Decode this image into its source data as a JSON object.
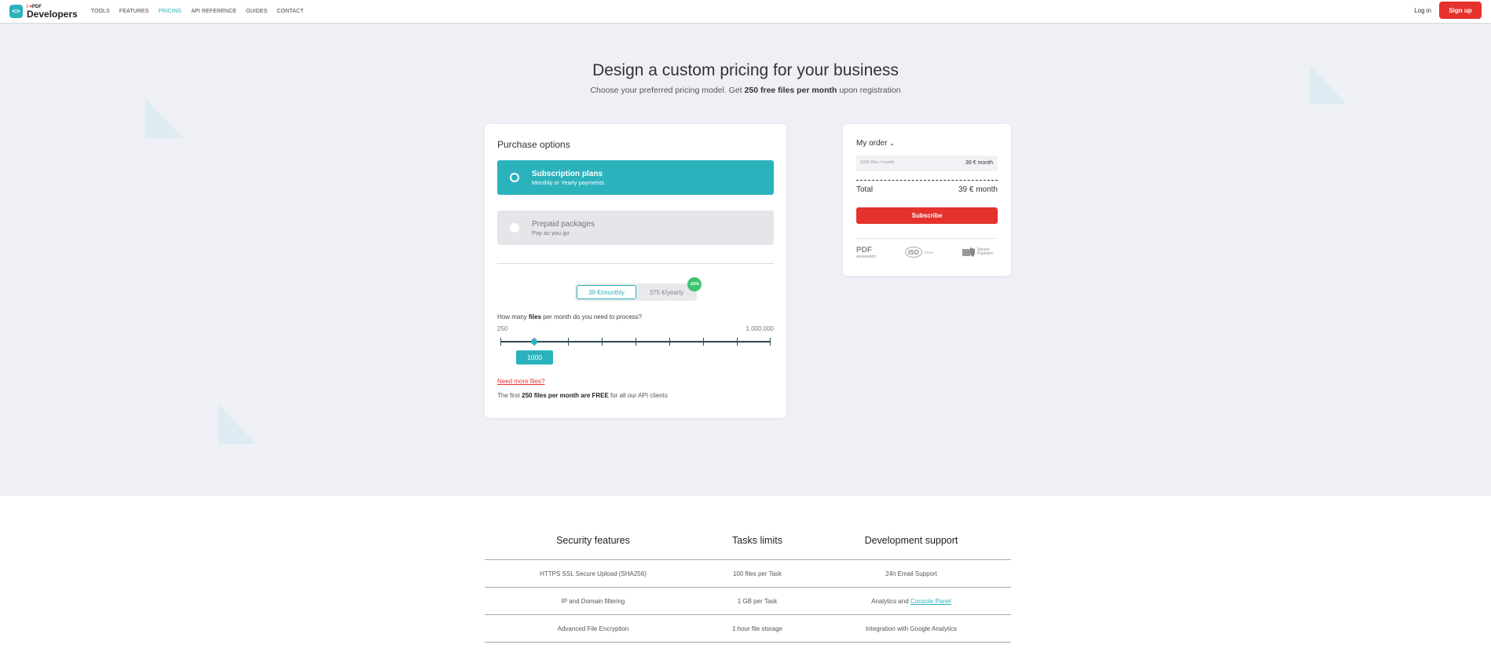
{
  "header": {
    "logo_small": "PDF",
    "logo_heart": "I ♥",
    "logo_big": "Developers",
    "nav": [
      "TOOLS",
      "FEATURES",
      "PRICING",
      "API REFERENCE",
      "GUIDES",
      "CONTACT"
    ],
    "active_nav": "PRICING",
    "login": "Log in",
    "signup": "Sign up"
  },
  "hero": {
    "title": "Design a custom pricing for your business",
    "sub_pre": "Choose your preferred pricing model. Get ",
    "sub_bold": "250 free files per month",
    "sub_post": " upon registration"
  },
  "purchase": {
    "title": "Purchase options",
    "options": [
      {
        "title": "Subscription plans",
        "sub": "Monthly or Yearly payments",
        "selected": true
      },
      {
        "title": "Prepaid packages",
        "sub": "Pay as you go",
        "selected": false
      }
    ],
    "toggle_monthly": "39 €/monthly",
    "toggle_yearly": "375 €/yearly",
    "discount_badge": "-20%",
    "question_pre": "How many ",
    "question_bold": "files",
    "question_post": " per month do you need to process?",
    "range_min": "250",
    "range_max": "1.000.000",
    "slider_value": "1000",
    "need_more": "Need more files?",
    "free_pre": "The first ",
    "free_bold": "250 files per month are FREE",
    "free_post": " for all our API clients"
  },
  "order": {
    "title": "My order",
    "item_label": "1000 files / month",
    "item_price": "39 € month",
    "total_label": "Total",
    "total_value": "39 € month",
    "subscribe": "Subscribe",
    "logo_pdf": "PDF",
    "logo_pdf_sub": "association",
    "logo_iso": "ISO",
    "logo_iso_sub": "27001",
    "logo_pay": "Secure Payment"
  },
  "features": {
    "columns": [
      "Security features",
      "Tasks limits",
      "Development support"
    ],
    "rows": [
      [
        "HTTPS SSL Secure Upload (SHA256)",
        "100 files per Task",
        "24h Email Support"
      ],
      [
        "IP and Domain filtering",
        "1 GB per Task",
        "Analytics and "
      ],
      [
        "Advanced File Encryption",
        "1 hour file storage",
        "Integration with Google Analytics"
      ]
    ],
    "console_link": "Console Panel"
  },
  "colors": {
    "accent": "#2bb3bd",
    "brand_red": "#e5322d",
    "badge_green": "#3dc36f",
    "page_bg": "#eef0f5"
  }
}
